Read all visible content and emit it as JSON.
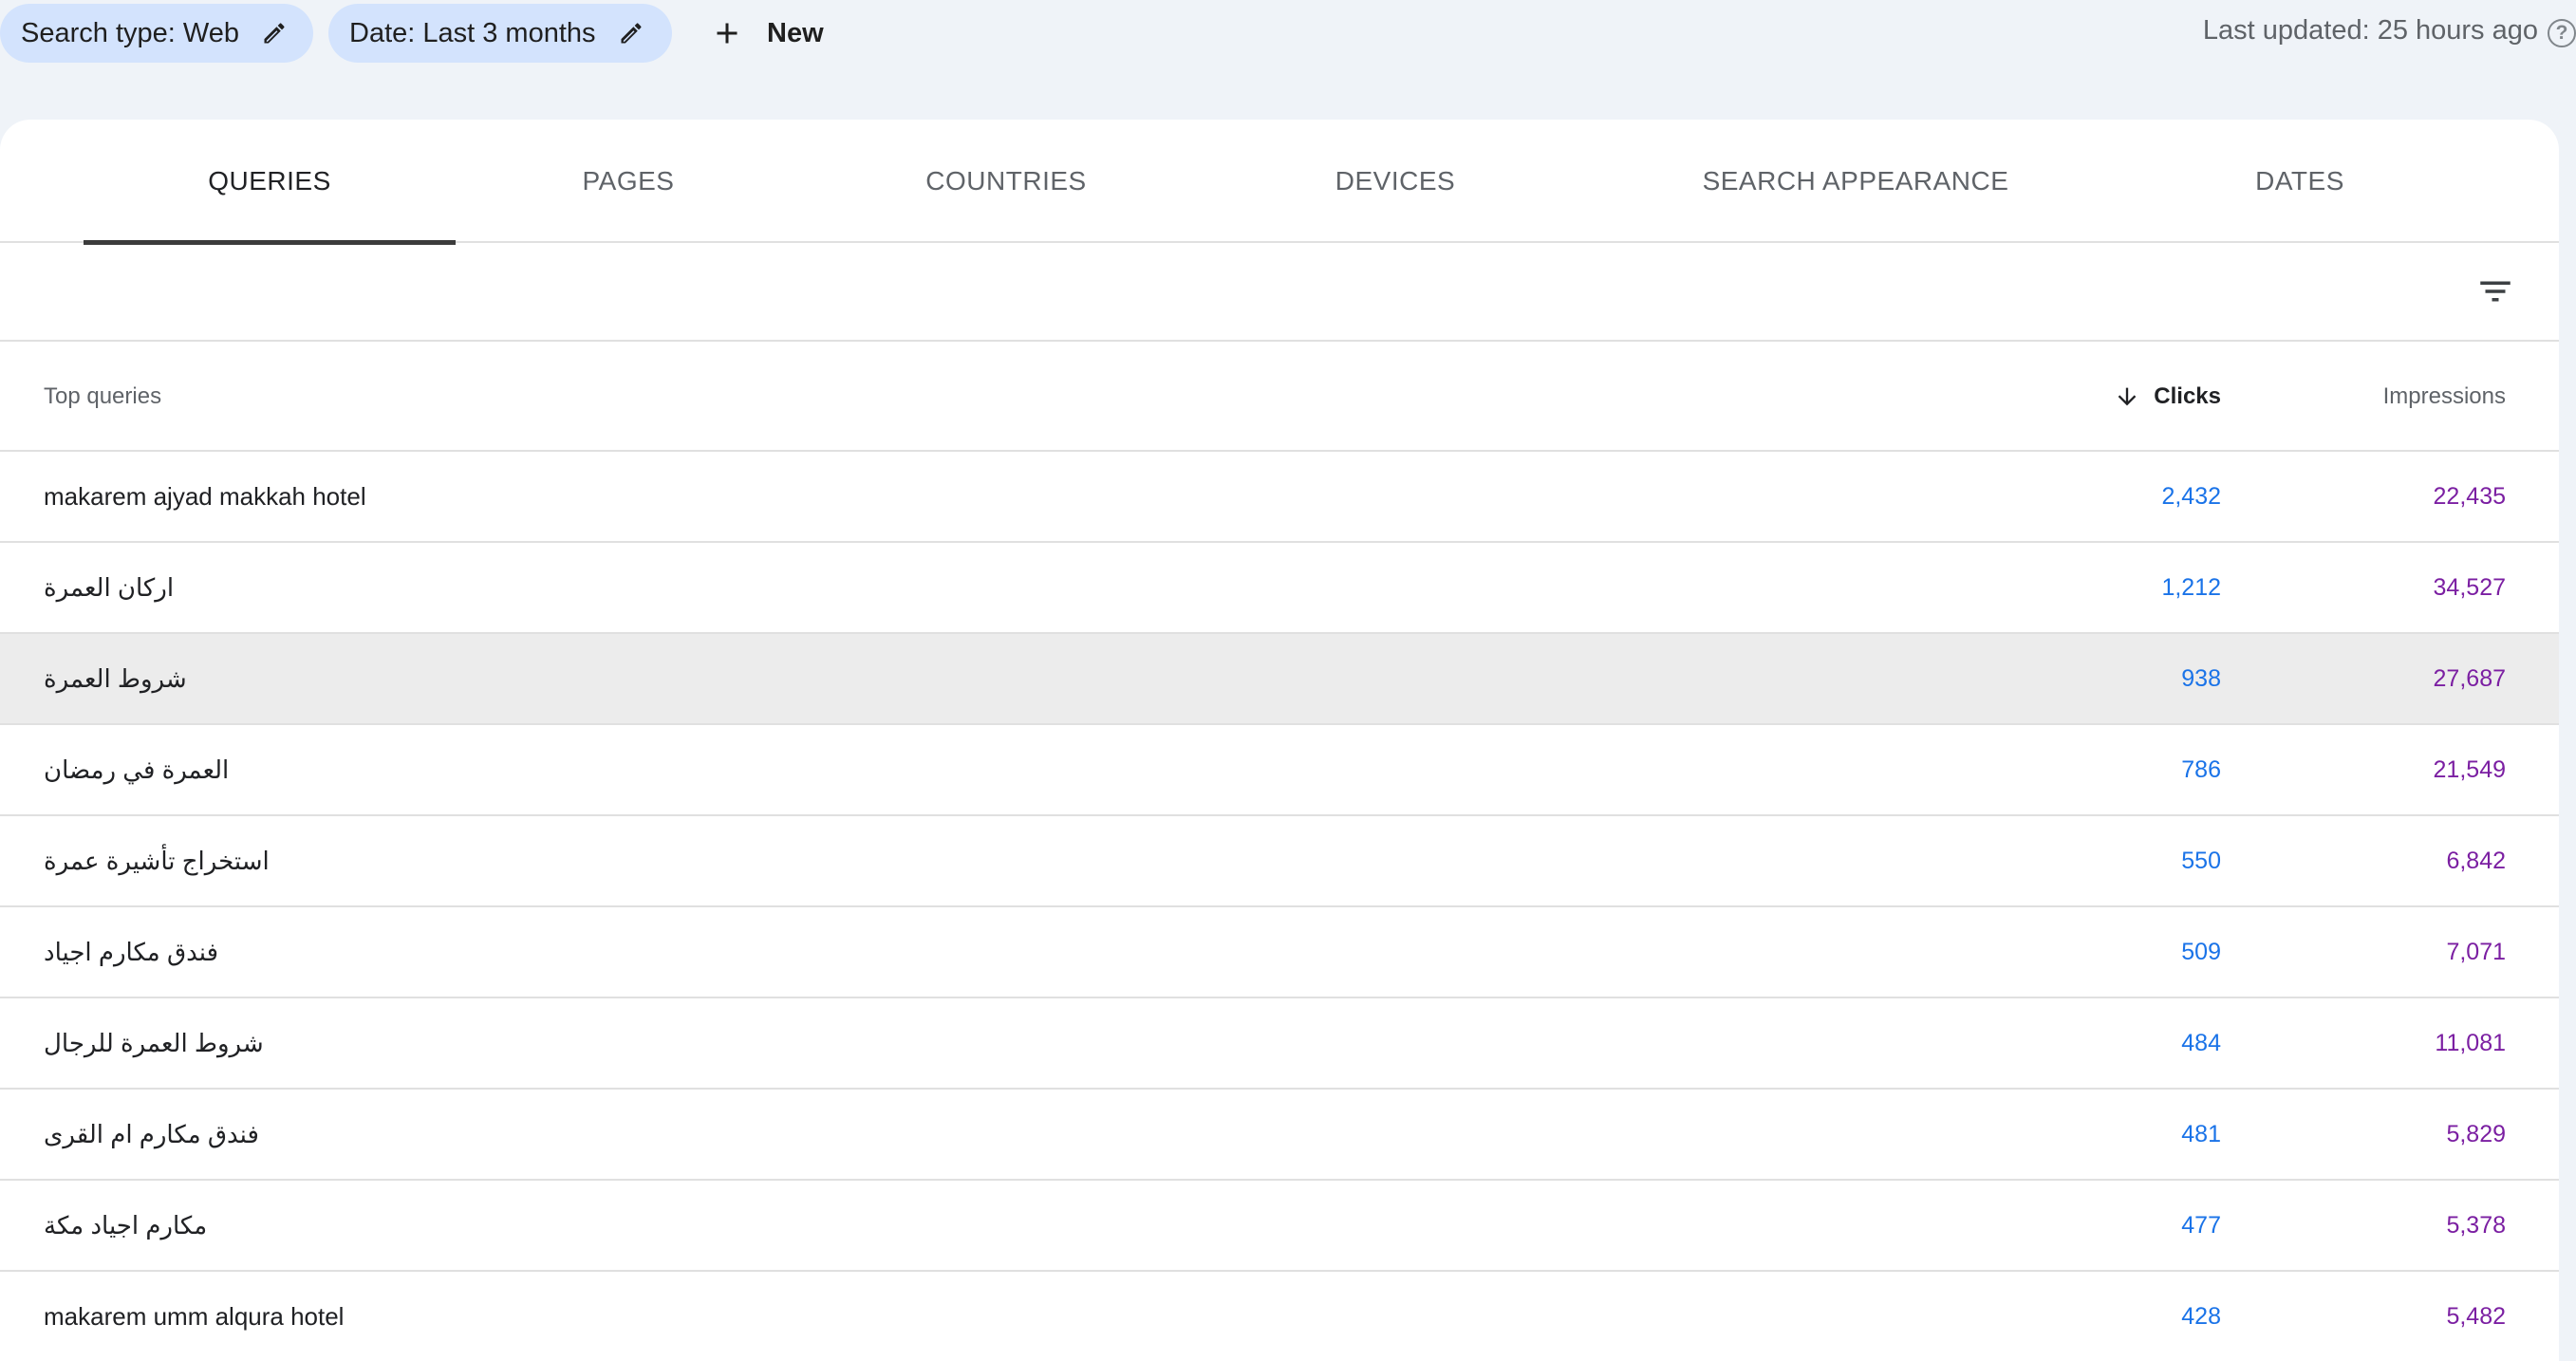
{
  "filters": {
    "search_type": "Search type: Web",
    "date": "Date: Last 3 months",
    "new_label": "New"
  },
  "status": {
    "last_updated": "Last updated: 25 hours ago",
    "help_glyph": "?"
  },
  "tabs": [
    {
      "label": "QUERIES",
      "active": true
    },
    {
      "label": "PAGES",
      "active": false
    },
    {
      "label": "COUNTRIES",
      "active": false
    },
    {
      "label": "DEVICES",
      "active": false
    },
    {
      "label": "SEARCH APPEARANCE",
      "active": false
    },
    {
      "label": "DATES",
      "active": false
    }
  ],
  "table": {
    "headers": {
      "query": "Top queries",
      "clicks": "Clicks",
      "impressions": "Impressions",
      "sort": "clicks-descending"
    },
    "rows": [
      {
        "query": "makarem ajyad makkah hotel",
        "clicks": "2,432",
        "impressions": "22,435"
      },
      {
        "query": "اركان العمرة",
        "clicks": "1,212",
        "impressions": "34,527"
      },
      {
        "query": "شروط العمرة",
        "clicks": "938",
        "impressions": "27,687"
      },
      {
        "query": "العمرة في رمضان",
        "clicks": "786",
        "impressions": "21,549"
      },
      {
        "query": "استخراج تأشيرة عمرة",
        "clicks": "550",
        "impressions": "6,842"
      },
      {
        "query": "فندق مكارم اجياد",
        "clicks": "509",
        "impressions": "7,071"
      },
      {
        "query": "شروط العمرة للرجال",
        "clicks": "484",
        "impressions": "11,081"
      },
      {
        "query": "فندق مكارم ام القرى",
        "clicks": "481",
        "impressions": "5,829"
      },
      {
        "query": "مكارم اجياد مكة",
        "clicks": "477",
        "impressions": "5,378"
      },
      {
        "query": "makarem umm alqura hotel",
        "clicks": "428",
        "impressions": "5,482"
      }
    ]
  },
  "colors": {
    "chip_bg": "#d3e3fd",
    "clicks": "#1a73e8",
    "impressions": "#7b1fa2",
    "hover_row": "#ececec"
  },
  "icons": {
    "edit": "pencil-icon",
    "new": "plus-icon",
    "help": "help-circle-icon",
    "filter": "filter-list-icon",
    "sort": "arrow-down-icon"
  }
}
